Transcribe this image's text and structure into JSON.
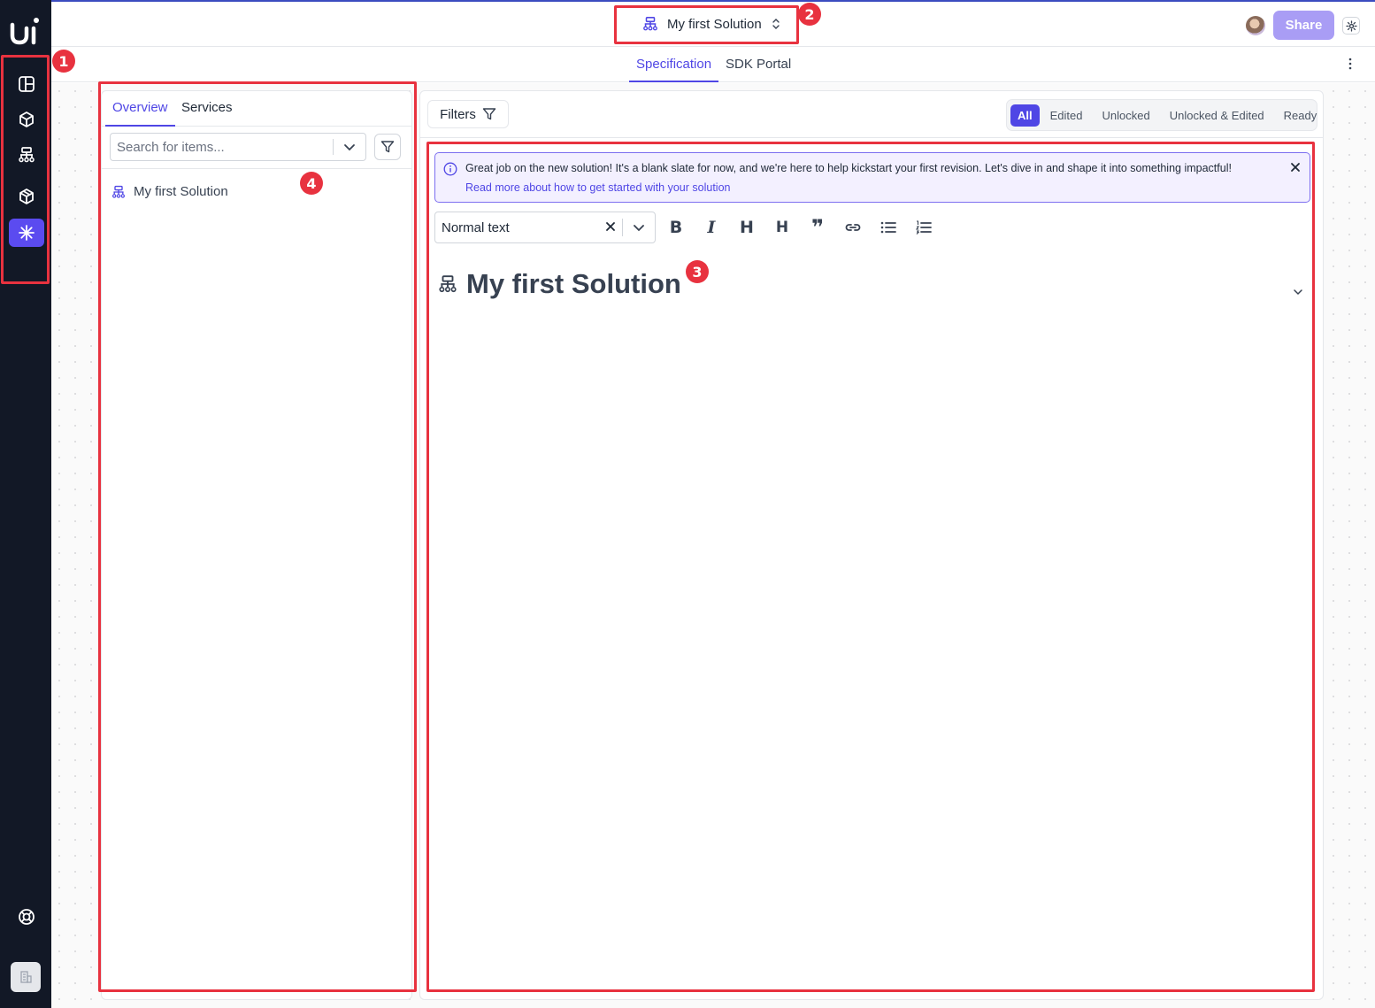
{
  "app": {
    "solution_name": "My first Solution",
    "share_label": "Share",
    "accent_color": "#4f46e5"
  },
  "nav": {
    "tabs": [
      {
        "label": "Specification",
        "active": true
      },
      {
        "label": "SDK Portal",
        "active": false
      }
    ]
  },
  "rail": {
    "items": [
      {
        "icon": "layout-icon"
      },
      {
        "icon": "cube-icon"
      },
      {
        "icon": "hierarchy-icon"
      },
      {
        "icon": "cube-alt-icon"
      },
      {
        "icon": "sparkle-icon",
        "active": true
      }
    ],
    "bottom": [
      {
        "icon": "lifebuoy-icon"
      },
      {
        "icon": "workspace-icon"
      }
    ]
  },
  "left_panel": {
    "tabs": [
      {
        "label": "Overview",
        "active": true
      },
      {
        "label": "Services",
        "active": false
      }
    ],
    "search_placeholder": "Search for items...",
    "items": [
      {
        "label": "My first Solution",
        "icon": "hierarchy-icon"
      }
    ]
  },
  "right_panel": {
    "filters_label": "Filters",
    "segments": [
      {
        "label": "All",
        "active": true
      },
      {
        "label": "Edited",
        "active": false
      },
      {
        "label": "Unlocked",
        "active": false
      },
      {
        "label": "Unlocked & Edited",
        "active": false
      },
      {
        "label": "Ready",
        "active": false
      }
    ],
    "banner": {
      "text": "Great job on the new solution! It's a blank slate for now, and we're here to help kickstart your first revision. Let's dive in and shape it into something impactful!",
      "link": "Read more about how to get started with your solution"
    },
    "editor": {
      "text_style": "Normal text",
      "tools": [
        {
          "icon": "bold-icon",
          "glyph": "B"
        },
        {
          "icon": "italic-icon",
          "glyph": "I"
        },
        {
          "icon": "heading-1-icon",
          "glyph": "H"
        },
        {
          "icon": "heading-2-icon",
          "glyph": "H"
        },
        {
          "icon": "quote-icon",
          "glyph": "❞"
        },
        {
          "icon": "link-icon"
        },
        {
          "icon": "bullet-list-icon"
        },
        {
          "icon": "numbered-list-icon"
        }
      ],
      "doc_title": "My first Solution"
    }
  },
  "annotations": [
    "1",
    "2",
    "3",
    "4"
  ]
}
